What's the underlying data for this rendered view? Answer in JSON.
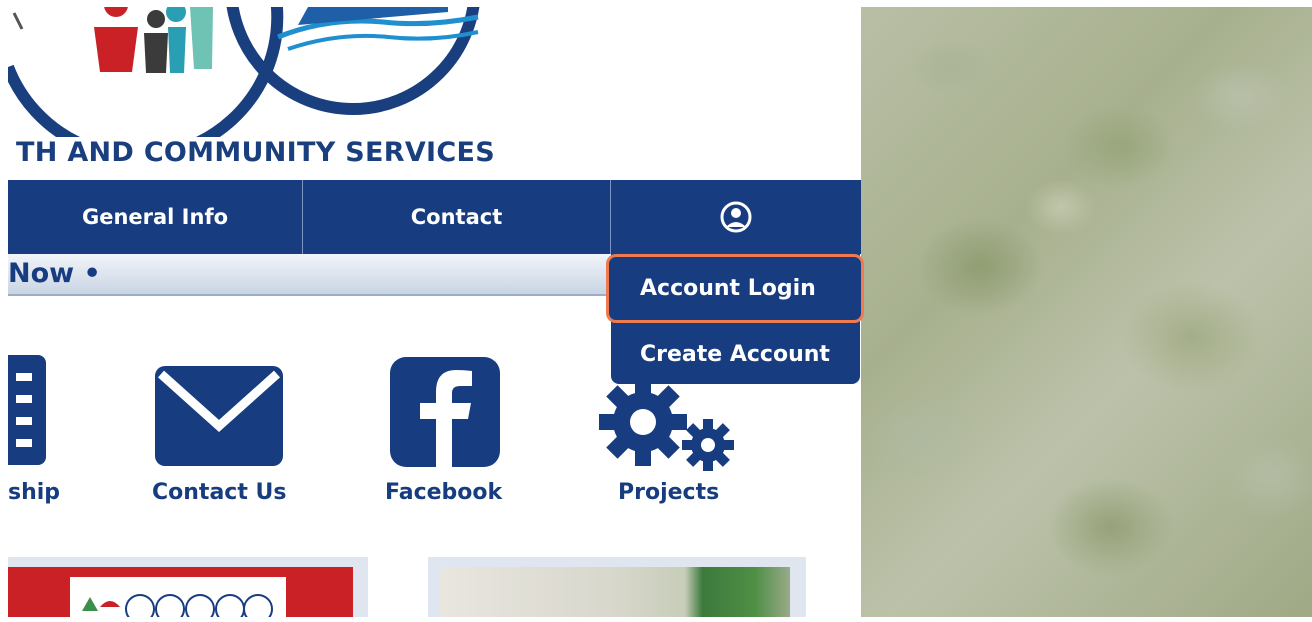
{
  "logo": {
    "org_text": "TH AND COMMUNITY SERVICES"
  },
  "nav": {
    "items": [
      {
        "label": "General Info"
      },
      {
        "label": "Contact"
      }
    ],
    "account_icon": "user-circle-icon"
  },
  "ticker": {
    "text": "Now •"
  },
  "account_menu": {
    "login_label": "Account Login",
    "create_label": "Create Account"
  },
  "quick_links": [
    {
      "label": "ship",
      "icon": "document-list-icon"
    },
    {
      "label": "Contact Us",
      "icon": "envelope-icon"
    },
    {
      "label": "Facebook",
      "icon": "facebook-icon"
    },
    {
      "label": "Projects",
      "icon": "gears-icon"
    }
  ],
  "colors": {
    "brand_blue": "#173d80",
    "highlight_orange": "#f07a4f",
    "alert_red": "#c92125"
  }
}
